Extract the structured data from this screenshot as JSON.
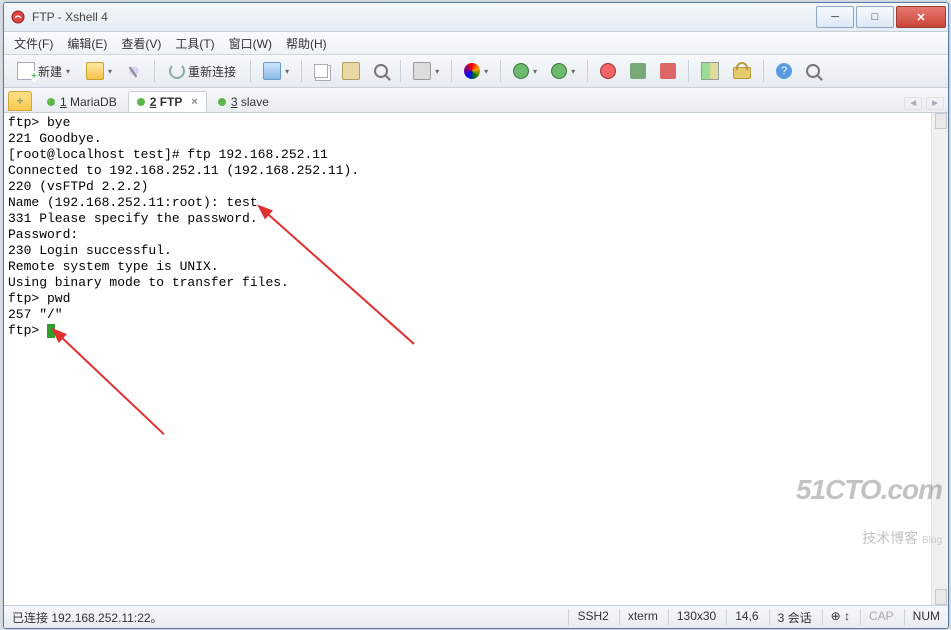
{
  "title": "FTP - Xshell 4",
  "menubar": {
    "file": "文件(F)",
    "edit": "编辑(E)",
    "view": "查看(V)",
    "tools": "工具(T)",
    "window": "窗口(W)",
    "help": "帮助(H)"
  },
  "toolbar": {
    "new_label": "新建",
    "reconnect_label": "重新连接"
  },
  "tabs": {
    "new": "+",
    "t1": "1 MariaDB",
    "t2": "2 FTP",
    "t3": "3 slave"
  },
  "terminal_lines": [
    "ftp> bye",
    "221 Goodbye.",
    "[root@localhost test]# ftp 192.168.252.11",
    "Connected to 192.168.252.11 (192.168.252.11).",
    "220 (vsFTPd 2.2.2)",
    "Name (192.168.252.11:root): test",
    "331 Please specify the password.",
    "Password:",
    "230 Login successful.",
    "Remote system type is UNIX.",
    "Using binary mode to transfer files.",
    "ftp> pwd",
    "257 \"/\"",
    "ftp> "
  ],
  "status": {
    "left": "已连接 192.168.252.11:22。",
    "ssh": "SSH2",
    "term": "xterm",
    "size": "130x30",
    "cursor": "14,6",
    "sessions": "3 会话",
    "cap": "CAP",
    "num": "NUM"
  },
  "watermark": {
    "l1": "51CTO.com",
    "l2": "技术博客",
    "l3": "Blog"
  }
}
